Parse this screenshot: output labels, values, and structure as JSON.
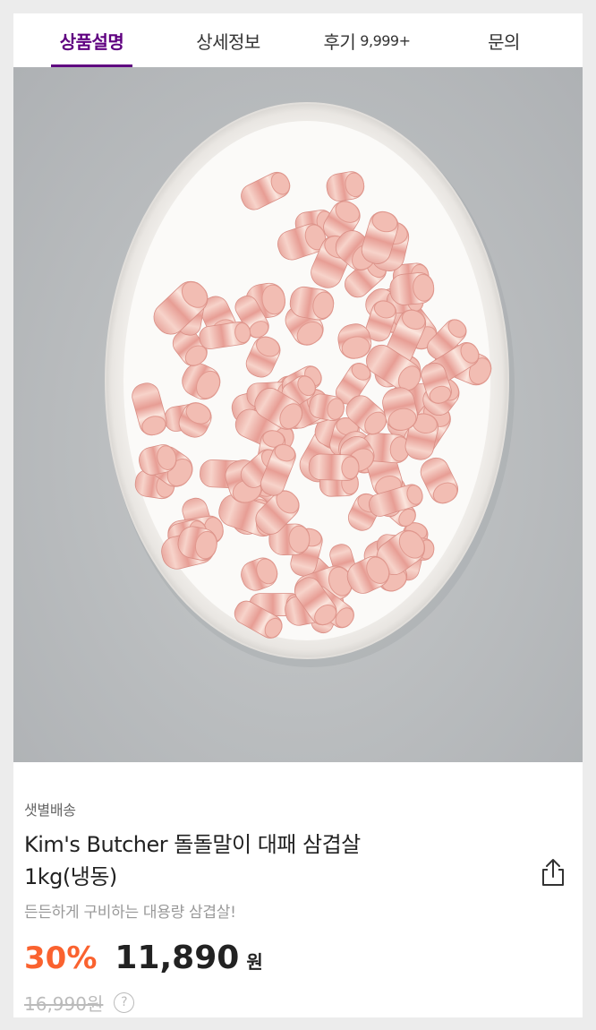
{
  "tabs": {
    "description": "상품설명",
    "details": "상세정보",
    "reviews": "후기",
    "review_count": "9,999+",
    "inquiry": "문의"
  },
  "product": {
    "delivery_type": "샛별배송",
    "name_line1": "Kim's Butcher 돌돌말이 대패 삼겹살",
    "name_line2": "1kg(냉동)",
    "subtitle": "든든하게 구비하는 대용량 삼겹살!",
    "discount_rate": "30%",
    "price": "11,890",
    "currency": "원",
    "original_price": "16,990원",
    "help_symbol": "?"
  },
  "icons": {
    "share": "share-icon",
    "help": "question-circle-icon"
  },
  "colors": {
    "brand": "#5f0080",
    "discount": "#fa622f"
  }
}
